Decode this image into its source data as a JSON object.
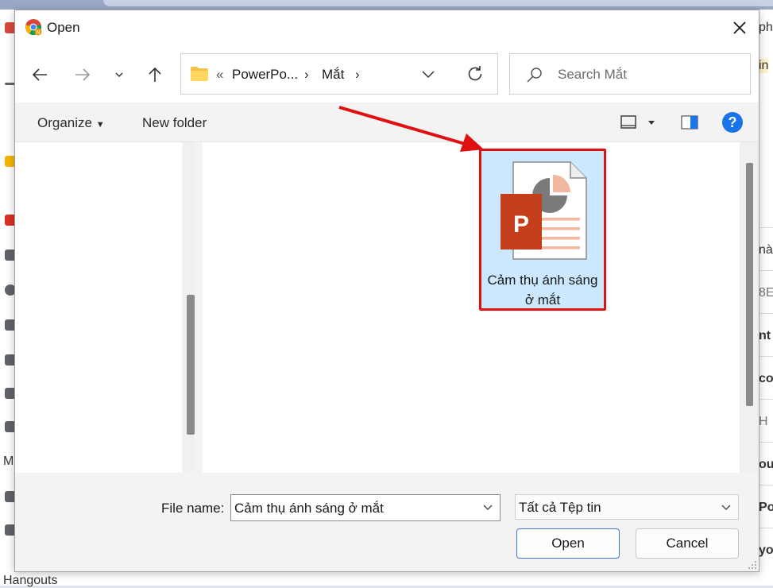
{
  "window": {
    "title": "Open"
  },
  "navigation": {
    "breadcrumb": {
      "overflow": "«",
      "items": [
        "PowerPo...",
        "Mắt"
      ],
      "separator": "›"
    },
    "search": {
      "placeholder": "Search Mắt"
    }
  },
  "toolbar": {
    "organize_label": "Organize",
    "new_folder_label": "New folder",
    "help_label": "?"
  },
  "files": [
    {
      "name": "Cảm thụ ánh sáng ở mắt",
      "type": "powerpoint",
      "selected": true
    }
  ],
  "footer": {
    "file_name_label": "File name:",
    "file_name_value": "Cảm thụ ánh sáng ở mắt",
    "file_type_value": "Tất cả Tệp tin",
    "open_label": "Open",
    "cancel_label": "Cancel"
  },
  "background": {
    "left_text": "M",
    "bottom_text": "Hangouts",
    "right_edge_texts": [
      "ph",
      "in",
      "nà",
      "8E",
      "nt",
      "co",
      "H",
      "ou",
      "Po",
      "yo"
    ]
  },
  "colors": {
    "accent": "#1a73e8",
    "selection": "#cce8ff",
    "highlight_border": "#e01010",
    "powerpoint": "#c43e1c"
  },
  "icons": [
    "chrome-icon",
    "close-icon",
    "back-arrow-icon",
    "forward-arrow-icon",
    "chevron-down-icon",
    "up-arrow-icon",
    "folder-icon",
    "refresh-icon",
    "search-icon",
    "view-icon",
    "preview-pane-icon",
    "help-icon",
    "powerpoint-file-icon"
  ]
}
